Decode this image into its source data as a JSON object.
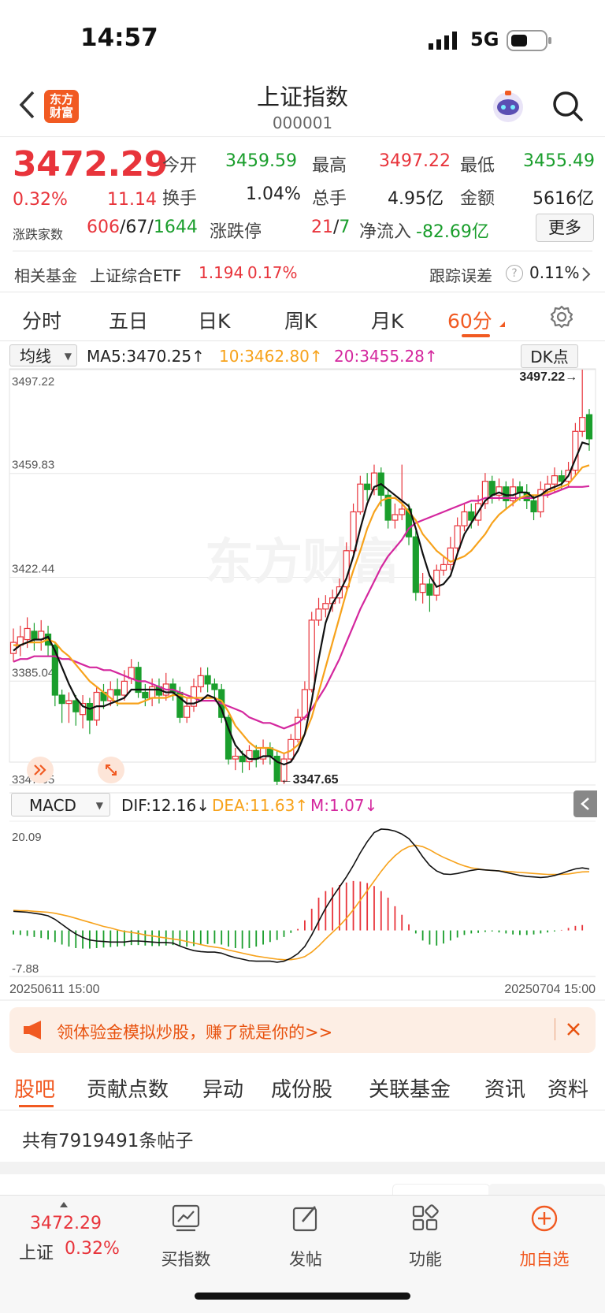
{
  "status_bar": {
    "time": "14:57",
    "network": "5G"
  },
  "nav": {
    "logo_line1": "东方",
    "logo_line2": "财富",
    "title": "上证指数",
    "code": "000001"
  },
  "quote": {
    "price": "3472.29",
    "change_pct": "0.32%",
    "change": "11.14",
    "open_label": "今开",
    "open": "3459.59",
    "high_label": "最高",
    "high": "3497.22",
    "low_label": "最低",
    "low": "3455.49",
    "turnover_label": "换手",
    "turnover": "1.04%",
    "volume_label": "总手",
    "volume": "4.95亿",
    "amount_label": "金额",
    "amount": "5616亿",
    "breadth_label": "涨跌家数",
    "up_count": "606",
    "flat_count": "67",
    "down_count": "1644",
    "limit_label": "涨跌停",
    "limit_up": "21",
    "limit_down": "7",
    "netflow_label": "净流入",
    "netflow": "-82.69亿",
    "more_button": "更多"
  },
  "fund": {
    "label": "相关基金",
    "name": "上证综合ETF",
    "price": "1.194",
    "change": "0.17%",
    "tracking_label": "跟踪误差",
    "tracking_value": "0.11%"
  },
  "tabs": [
    {
      "label": "分时"
    },
    {
      "label": "五日"
    },
    {
      "label": "日K"
    },
    {
      "label": "周K"
    },
    {
      "label": "月K"
    },
    {
      "label": "60分"
    }
  ],
  "ma_bar": {
    "selector": "均线",
    "ma5": "MA5:3470.25↑",
    "ma10": "10:3462.80↑",
    "ma20": "20:3455.28↑",
    "dk_button": "DK点"
  },
  "macd_bar": {
    "selector": "MACD",
    "dif": "DIF:12.16↓",
    "dea": "DEA:11.63↑",
    "m": "M:1.07↓"
  },
  "chart_data": {
    "type": "candlestick",
    "y_ticks": [
      "3497.22",
      "3459.83",
      "3422.44",
      "3385.04",
      "3347.65"
    ],
    "ylim": [
      3347.65,
      3497.22
    ],
    "max_label": "3497.22→",
    "min_label": "←3347.65",
    "macd_ticks": [
      "20.09",
      "-7.88"
    ],
    "macd_ylim": [
      -7.88,
      20.09
    ],
    "x_start": "20250611 15:00",
    "x_end": "20250704 15:00",
    "colors": {
      "up": "#e8343b",
      "down": "#1a9e2c",
      "ma5": "#111111",
      "ma10": "#f7a21b",
      "ma20": "#d4279e"
    },
    "candles": [
      {
        "o": 3395,
        "c": 3399,
        "h": 3404,
        "l": 3392
      },
      {
        "o": 3398,
        "c": 3401,
        "h": 3405,
        "l": 3394
      },
      {
        "o": 3400,
        "c": 3404,
        "h": 3408,
        "l": 3397
      },
      {
        "o": 3403,
        "c": 3400,
        "h": 3406,
        "l": 3396
      },
      {
        "o": 3400,
        "c": 3403,
        "h": 3407,
        "l": 3396
      },
      {
        "o": 3402,
        "c": 3398,
        "h": 3405,
        "l": 3394
      },
      {
        "o": 3398,
        "c": 3380,
        "h": 3399,
        "l": 3376
      },
      {
        "o": 3380,
        "c": 3377,
        "h": 3382,
        "l": 3370
      },
      {
        "o": 3377,
        "c": 3378,
        "h": 3381,
        "l": 3370
      },
      {
        "o": 3378,
        "c": 3374,
        "h": 3380,
        "l": 3369
      },
      {
        "o": 3373,
        "c": 3377,
        "h": 3380,
        "l": 3368
      },
      {
        "o": 3377,
        "c": 3371,
        "h": 3379,
        "l": 3366
      },
      {
        "o": 3371,
        "c": 3381,
        "h": 3383,
        "l": 3369
      },
      {
        "o": 3381,
        "c": 3378,
        "h": 3384,
        "l": 3375
      },
      {
        "o": 3378,
        "c": 3382,
        "h": 3385,
        "l": 3376
      },
      {
        "o": 3382,
        "c": 3380,
        "h": 3386,
        "l": 3376
      },
      {
        "o": 3380,
        "c": 3385,
        "h": 3389,
        "l": 3378
      },
      {
        "o": 3386,
        "c": 3390,
        "h": 3393,
        "l": 3384
      },
      {
        "o": 3390,
        "c": 3381,
        "h": 3392,
        "l": 3379
      },
      {
        "o": 3381,
        "c": 3379,
        "h": 3384,
        "l": 3376
      },
      {
        "o": 3379,
        "c": 3383,
        "h": 3386,
        "l": 3376
      },
      {
        "o": 3383,
        "c": 3380,
        "h": 3386,
        "l": 3377
      },
      {
        "o": 3380,
        "c": 3384,
        "h": 3388,
        "l": 3378
      },
      {
        "o": 3384,
        "c": 3381,
        "h": 3386,
        "l": 3378
      },
      {
        "o": 3381,
        "c": 3372,
        "h": 3383,
        "l": 3370
      },
      {
        "o": 3372,
        "c": 3376,
        "h": 3379,
        "l": 3370
      },
      {
        "o": 3376,
        "c": 3383,
        "h": 3386,
        "l": 3374
      },
      {
        "o": 3383,
        "c": 3387,
        "h": 3390,
        "l": 3381
      },
      {
        "o": 3387,
        "c": 3384,
        "h": 3390,
        "l": 3381
      },
      {
        "o": 3384,
        "c": 3382,
        "h": 3386,
        "l": 3378
      },
      {
        "o": 3382,
        "c": 3372,
        "h": 3384,
        "l": 3370
      },
      {
        "o": 3372,
        "c": 3357,
        "h": 3373,
        "l": 3355
      },
      {
        "o": 3357,
        "c": 3358,
        "h": 3361,
        "l": 3353
      },
      {
        "o": 3358,
        "c": 3356,
        "h": 3360,
        "l": 3352
      },
      {
        "o": 3356,
        "c": 3360,
        "h": 3362,
        "l": 3353
      },
      {
        "o": 3360,
        "c": 3357,
        "h": 3362,
        "l": 3354
      },
      {
        "o": 3357,
        "c": 3361,
        "h": 3364,
        "l": 3355
      },
      {
        "o": 3361,
        "c": 3358,
        "h": 3363,
        "l": 3355
      },
      {
        "o": 3358,
        "c": 3349,
        "h": 3360,
        "l": 3347.65
      },
      {
        "o": 3349,
        "c": 3357,
        "h": 3359,
        "l": 3348
      },
      {
        "o": 3357,
        "c": 3364,
        "h": 3366,
        "l": 3356
      },
      {
        "o": 3364,
        "c": 3372,
        "h": 3375,
        "l": 3363
      },
      {
        "o": 3372,
        "c": 3382,
        "h": 3385,
        "l": 3371
      },
      {
        "o": 3382,
        "c": 3407,
        "h": 3410,
        "l": 3381
      },
      {
        "o": 3407,
        "c": 3411,
        "h": 3415,
        "l": 3405
      },
      {
        "o": 3411,
        "c": 3413,
        "h": 3416,
        "l": 3408
      },
      {
        "o": 3413,
        "c": 3415,
        "h": 3418,
        "l": 3410
      },
      {
        "o": 3415,
        "c": 3419,
        "h": 3422,
        "l": 3413
      },
      {
        "o": 3419,
        "c": 3432,
        "h": 3435,
        "l": 3418
      },
      {
        "o": 3432,
        "c": 3446,
        "h": 3449,
        "l": 3431
      },
      {
        "o": 3446,
        "c": 3456,
        "h": 3459,
        "l": 3445
      },
      {
        "o": 3456,
        "c": 3454,
        "h": 3460,
        "l": 3450
      },
      {
        "o": 3454,
        "c": 3460,
        "h": 3463,
        "l": 3452
      },
      {
        "o": 3460,
        "c": 3452,
        "h": 3462,
        "l": 3448
      },
      {
        "o": 3452,
        "c": 3443,
        "h": 3454,
        "l": 3440
      },
      {
        "o": 3443,
        "c": 3445,
        "h": 3449,
        "l": 3440
      },
      {
        "o": 3445,
        "c": 3447,
        "h": 3463,
        "l": 3443
      },
      {
        "o": 3447,
        "c": 3437,
        "h": 3449,
        "l": 3434
      },
      {
        "o": 3437,
        "c": 3417,
        "h": 3439,
        "l": 3414
      },
      {
        "o": 3417,
        "c": 3420,
        "h": 3424,
        "l": 3413
      },
      {
        "o": 3420,
        "c": 3416,
        "h": 3422,
        "l": 3410
      },
      {
        "o": 3416,
        "c": 3425,
        "h": 3427,
        "l": 3414
      },
      {
        "o": 3425,
        "c": 3427,
        "h": 3430,
        "l": 3423
      },
      {
        "o": 3427,
        "c": 3433,
        "h": 3437,
        "l": 3425
      },
      {
        "o": 3433,
        "c": 3441,
        "h": 3444,
        "l": 3431
      },
      {
        "o": 3441,
        "c": 3446,
        "h": 3449,
        "l": 3439
      },
      {
        "o": 3446,
        "c": 3443,
        "h": 3449,
        "l": 3440
      },
      {
        "o": 3443,
        "c": 3449,
        "h": 3452,
        "l": 3441
      },
      {
        "o": 3449,
        "c": 3457,
        "h": 3460,
        "l": 3447
      },
      {
        "o": 3457,
        "c": 3452,
        "h": 3459,
        "l": 3449
      },
      {
        "o": 3452,
        "c": 3455,
        "h": 3458,
        "l": 3450
      },
      {
        "o": 3455,
        "c": 3450,
        "h": 3457,
        "l": 3447
      },
      {
        "o": 3450,
        "c": 3455,
        "h": 3458,
        "l": 3448
      },
      {
        "o": 3455,
        "c": 3453,
        "h": 3457,
        "l": 3450
      },
      {
        "o": 3453,
        "c": 3450,
        "h": 3456,
        "l": 3447
      },
      {
        "o": 3450,
        "c": 3446,
        "h": 3452,
        "l": 3443
      },
      {
        "o": 3446,
        "c": 3454,
        "h": 3457,
        "l": 3444
      },
      {
        "o": 3454,
        "c": 3456,
        "h": 3459,
        "l": 3451
      },
      {
        "o": 3456,
        "c": 3459,
        "h": 3462,
        "l": 3453
      },
      {
        "o": 3459,
        "c": 3457,
        "h": 3461,
        "l": 3454
      },
      {
        "o": 3457,
        "c": 3461,
        "h": 3464,
        "l": 3455
      },
      {
        "o": 3461,
        "c": 3475,
        "h": 3478,
        "l": 3459
      },
      {
        "o": 3475,
        "c": 3480,
        "h": 3497.22,
        "l": 3473
      },
      {
        "o": 3481,
        "c": 3472.29,
        "h": 3483,
        "l": 3468
      }
    ],
    "ma5": [
      3396,
      3398,
      3399,
      3400,
      3400,
      3401,
      3396,
      3390,
      3384,
      3379,
      3376,
      3375,
      3376,
      3376,
      3377,
      3378,
      3379,
      3382,
      3382,
      3382,
      3382,
      3382,
      3381,
      3381,
      3379,
      3377,
      3377,
      3378,
      3380,
      3379,
      3375,
      3368,
      3362,
      3359,
      3357,
      3357,
      3358,
      3358,
      3356,
      3355,
      3356,
      3360,
      3366,
      3378,
      3393,
      3406,
      3413,
      3417,
      3422,
      3430,
      3440,
      3449,
      3455,
      3456,
      3454,
      3452,
      3450,
      3448,
      3440,
      3431,
      3423,
      3419,
      3420,
      3423,
      3431,
      3438,
      3442,
      3446,
      3450,
      3452,
      3453,
      3452,
      3452,
      3453,
      3453,
      3451,
      3452,
      3454,
      3455,
      3456,
      3459,
      3465,
      3471,
      3470.25
    ],
    "ma10": [
      3398,
      3398,
      3399,
      3399,
      3399,
      3400,
      3399,
      3396,
      3394,
      3391,
      3388,
      3385,
      3383,
      3381,
      3379,
      3377,
      3377,
      3377,
      3377,
      3378,
      3379,
      3379,
      3379,
      3380,
      3380,
      3379,
      3379,
      3379,
      3379,
      3379,
      3378,
      3374,
      3369,
      3366,
      3363,
      3361,
      3361,
      3361,
      3360,
      3359,
      3360,
      3362,
      3366,
      3372,
      3381,
      3390,
      3399,
      3408,
      3417,
      3425,
      3432,
      3440,
      3446,
      3450,
      3451,
      3451,
      3449,
      3446,
      3443,
      3438,
      3435,
      3432,
      3430,
      3428,
      3429,
      3430,
      3432,
      3435,
      3438,
      3442,
      3445,
      3447,
      3449,
      3451,
      3452,
      3452,
      3452,
      3453,
      3454,
      3455,
      3456,
      3459,
      3462,
      3462.8
    ],
    "ma20": [
      3392,
      3393,
      3393,
      3394,
      3394,
      3394,
      3394,
      3393,
      3393,
      3392,
      3391,
      3390,
      3390,
      3389,
      3389,
      3388,
      3387,
      3386,
      3385,
      3385,
      3384,
      3383,
      3382,
      3382,
      3381,
      3380,
      3379,
      3378,
      3378,
      3378,
      3377,
      3376,
      3375,
      3374,
      3372,
      3371,
      3370,
      3370,
      3369,
      3368,
      3369,
      3370,
      3372,
      3375,
      3379,
      3383,
      3388,
      3393,
      3399,
      3405,
      3411,
      3416,
      3421,
      3426,
      3430,
      3433,
      3436,
      3440,
      3442,
      3443,
      3444,
      3445,
      3446,
      3447,
      3448,
      3449,
      3450,
      3450,
      3451,
      3451,
      3451,
      3451,
      3451,
      3451,
      3451,
      3451,
      3452,
      3452,
      3453,
      3454,
      3455,
      3455,
      3455,
      3455.28
    ],
    "macd_hist": [
      -0.8,
      -0.9,
      -1.1,
      -1.3,
      -1.5,
      -1.8,
      -2.3,
      -2.8,
      -3.2,
      -3.5,
      -3.6,
      -3.6,
      -3.5,
      -3.4,
      -3.3,
      -3.2,
      -3.1,
      -2.9,
      -2.9,
      -3.0,
      -3.1,
      -3.1,
      -3.0,
      -2.9,
      -3.0,
      -3.2,
      -3.1,
      -2.9,
      -2.7,
      -2.6,
      -2.8,
      -3.2,
      -3.5,
      -3.6,
      -3.5,
      -3.2,
      -2.8,
      -2.3,
      -1.9,
      -1.3,
      -0.5,
      0.3,
      2.0,
      4.3,
      6.5,
      7.8,
      8.5,
      9.0,
      9.5,
      9.8,
      9.7,
      9.4,
      8.8,
      7.8,
      6.5,
      4.8,
      3.1,
      1.2,
      -0.6,
      -2.0,
      -2.8,
      -3.0,
      -2.6,
      -2.0,
      -1.4,
      -0.9,
      -0.6,
      -0.5,
      -0.3,
      -0.2,
      -0.4,
      -0.6,
      -0.8,
      -0.9,
      -0.9,
      -0.8,
      -0.6,
      -0.4,
      -0.2,
      0.1,
      0.5,
      0.9,
      1.07
    ],
    "dif": [
      3.8,
      3.7,
      3.6,
      3.4,
      3.2,
      2.9,
      2.2,
      1.2,
      0.2,
      -0.7,
      -1.4,
      -1.9,
      -2.1,
      -2.2,
      -2.3,
      -2.3,
      -2.3,
      -2.1,
      -2.1,
      -2.2,
      -2.3,
      -2.4,
      -2.4,
      -2.5,
      -3.1,
      -3.6,
      -4.0,
      -4.2,
      -4.3,
      -4.3,
      -4.5,
      -5.0,
      -5.4,
      -5.7,
      -6.0,
      -6.1,
      -6.1,
      -6.1,
      -6.3,
      -6.1,
      -5.5,
      -4.6,
      -3.2,
      -0.9,
      1.8,
      4.4,
      6.6,
      8.6,
      10.6,
      12.9,
      15.4,
      17.6,
      19.4,
      20.09,
      20.0,
      19.7,
      19.1,
      18.2,
      16.6,
      14.6,
      12.9,
      11.8,
      11.2,
      11.1,
      11.3,
      11.6,
      11.9,
      12.1,
      12.0,
      11.9,
      11.8,
      11.5,
      11.2,
      10.9,
      10.7,
      10.6,
      10.5,
      10.6,
      10.9,
      11.3,
      11.8,
      12.2,
      12.4,
      12.16
    ],
    "dea": [
      4.0,
      3.9,
      3.9,
      3.8,
      3.7,
      3.6,
      3.4,
      3.1,
      2.8,
      2.4,
      2.0,
      1.6,
      1.2,
      0.8,
      0.5,
      0.1,
      -0.2,
      -0.4,
      -0.6,
      -0.9,
      -1.1,
      -1.3,
      -1.5,
      -1.7,
      -1.9,
      -2.2,
      -2.5,
      -2.8,
      -3.1,
      -3.3,
      -3.5,
      -3.9,
      -4.2,
      -4.5,
      -4.8,
      -5.1,
      -5.3,
      -5.5,
      -5.7,
      -5.8,
      -5.8,
      -5.6,
      -5.2,
      -4.3,
      -3.1,
      -1.7,
      -0.4,
      0.9,
      2.4,
      4.1,
      6.0,
      7.9,
      9.8,
      11.7,
      13.4,
      14.8,
      15.9,
      16.6,
      16.9,
      16.6,
      16.0,
      15.2,
      14.5,
      13.9,
      13.3,
      12.8,
      12.4,
      12.2,
      12.0,
      11.9,
      11.8,
      11.7,
      11.6,
      11.5,
      11.4,
      11.3,
      11.2,
      11.1,
      11.1,
      11.1,
      11.2,
      11.4,
      11.6,
      11.63
    ]
  },
  "banner": {
    "text": "领体验金模拟炒股，赚了就是你的>>"
  },
  "sub_tabs": [
    {
      "label": "股吧"
    },
    {
      "label": "贡献点数"
    },
    {
      "label": "异动"
    },
    {
      "label": "成份股"
    },
    {
      "label": "关联基金"
    },
    {
      "label": "资讯"
    },
    {
      "label": "资料"
    }
  ],
  "posts": {
    "text": "共有7919491条帖子"
  },
  "bottom_bar": {
    "price": "3472.29",
    "name": "上证",
    "change": "0.32%",
    "buy_label": "买指数",
    "post_label": "发帖",
    "func_label": "功能",
    "add_label": "加自选"
  },
  "watermark": "东方财富"
}
